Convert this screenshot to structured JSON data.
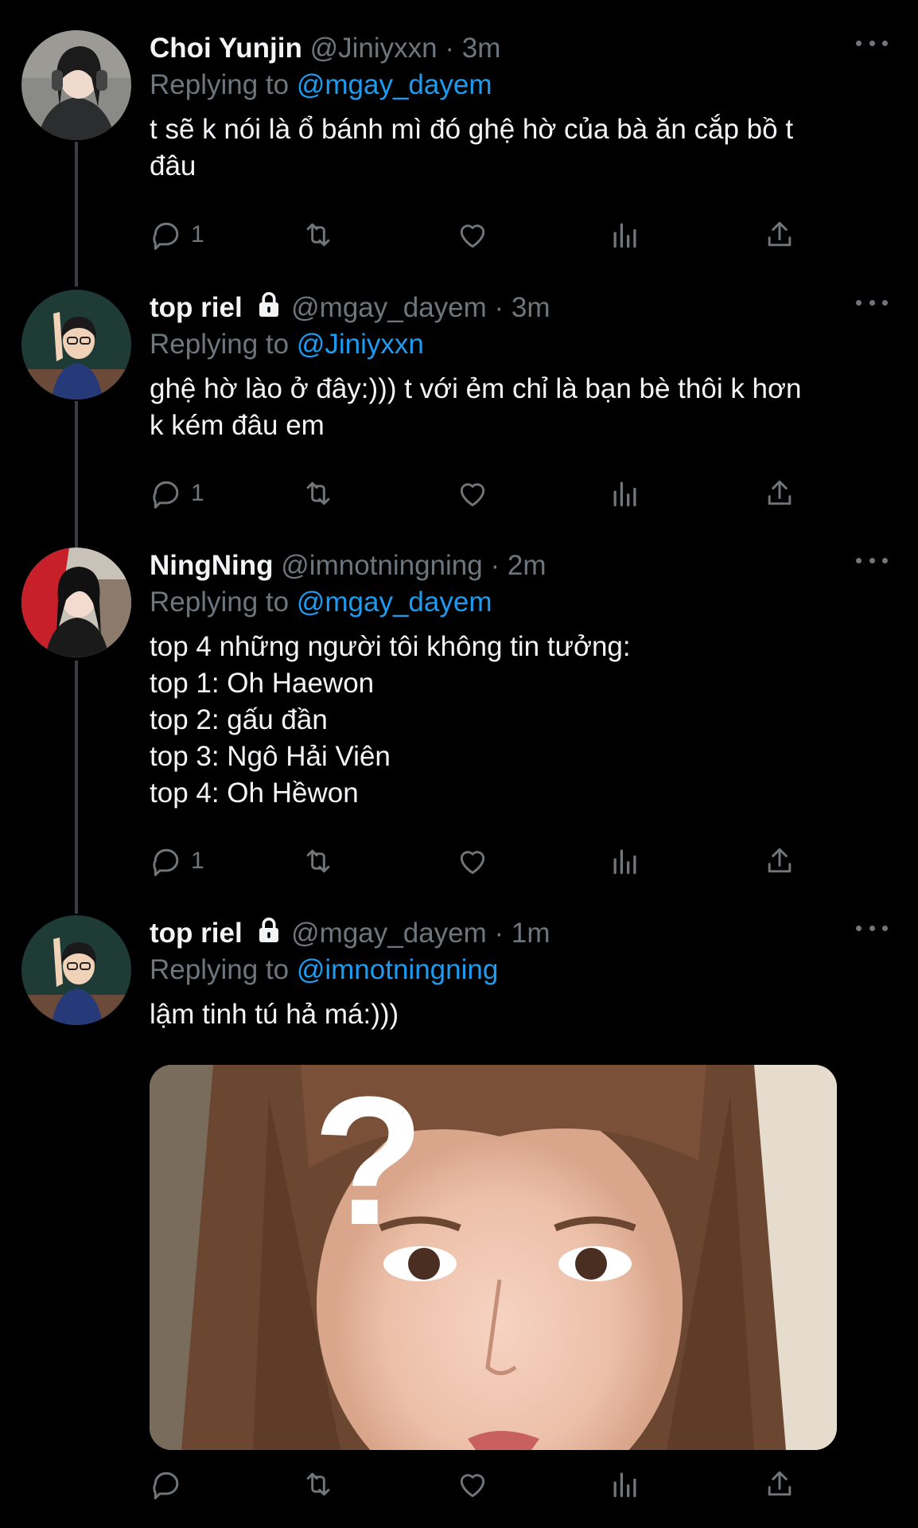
{
  "tweets": [
    {
      "name": "Choi Yunjin",
      "handle": "@Jiniyxxn",
      "sep": "·",
      "time": "3m",
      "locked": false,
      "reply_prefix": "Replying to",
      "reply_to": "@mgay_dayem",
      "text": "t sẽ k nói là ổ bánh mì đó ghệ hờ của bà ăn cắp bồ t\nđâu",
      "reply_count": "1"
    },
    {
      "name": "top riel",
      "handle": "@mgay_dayem",
      "sep": "·",
      "time": "3m",
      "locked": true,
      "reply_prefix": "Replying to",
      "reply_to": "@Jiniyxxn",
      "text": "ghệ hờ lào ở đây:))) t với ẻm chỉ là bạn bè thôi k hơn\nk kém đâu em",
      "reply_count": "1"
    },
    {
      "name": "NingNing",
      "handle": "@imnotningning",
      "sep": "·",
      "time": "2m",
      "locked": false,
      "reply_prefix": "Replying to",
      "reply_to": "@mgay_dayem",
      "text": "top 4 những người tôi không tin tưởng:\ntop 1: Oh Haewon\ntop 2: gấu đần\ntop 3: Ngô Hải Viên\ntop 4: Oh Hềwon",
      "reply_count": "1"
    },
    {
      "name": "top riel",
      "handle": "@mgay_dayem",
      "sep": "·",
      "time": "1m",
      "locked": true,
      "reply_prefix": "Replying to",
      "reply_to": "@imnotningning",
      "text": "lậm tinh tú hả má:)))",
      "reply_count": "",
      "media_overlay": "?"
    }
  ],
  "icons": {
    "reply": "reply-icon",
    "retweet": "retweet-icon",
    "like": "heart-icon",
    "analytics": "analytics-icon",
    "share": "share-icon",
    "more": "more-icon",
    "lock": "lock-icon"
  },
  "colors": {
    "background": "#000000",
    "text": "#e7e9ea",
    "muted": "#6e767d",
    "link": "#1d9bf0"
  }
}
